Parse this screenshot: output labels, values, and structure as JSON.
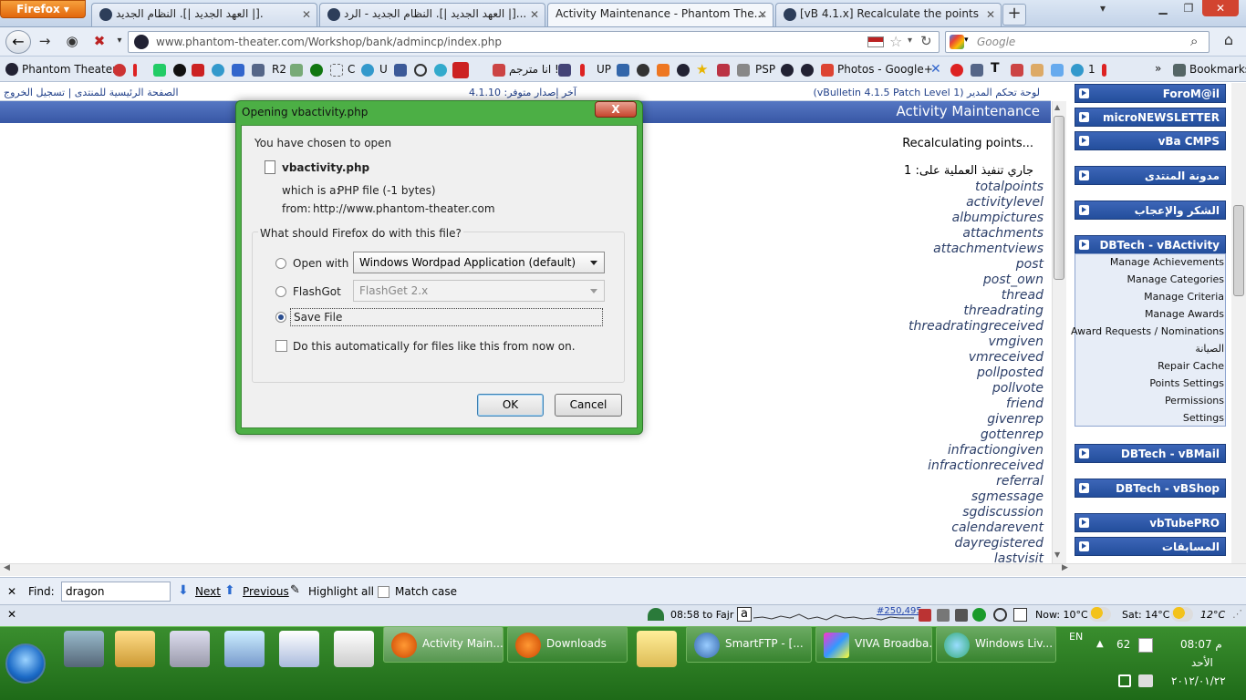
{
  "browser": {
    "menu_button": "Firefox ▾",
    "tabs": [
      {
        "label": "العهد الجديد |]. النظام الجديد |]."
      },
      {
        "label": "العهد الجديد |]. النظام الجديد - الرد |]..."
      },
      {
        "label": "Activity Maintenance - Phantom The..."
      },
      {
        "label": "[vB 4.1.x] Recalculate the points"
      }
    ],
    "url": "www.phantom-theater.com/Workshop/bank/admincp/index.php",
    "search_placeholder": "Google",
    "bookmarks": [
      "Phantom Theater",
      "R2",
      "C",
      "U",
      "انا مترجم !!",
      "UP",
      "PSP",
      "Photos - Google+",
      "1",
      "Bookmarks"
    ]
  },
  "page": {
    "top_left_links": "الصفحة الرئيسية للمنتدى | تسجيل الخروج",
    "top_mid": "آخر إصدار متوفر: 4.1.10",
    "top_right": "لوحة تحكم المدير (vBulletin 4.1.5 Patch Level 1)",
    "header_title": "Activity Maintenance",
    "recalc": "Recalculating points...",
    "running": "جاري تنفيذ العملية على: 1",
    "items": [
      "totalpoints",
      "activitylevel",
      "albumpictures",
      "attachments",
      "attachmentviews",
      "post",
      "post_own",
      "thread",
      "threadrating",
      "threadratingreceived",
      "vmgiven",
      "vmreceived",
      "pollposted",
      "pollvote",
      "friend",
      "givenrep",
      "gottenrep",
      "infractiongiven",
      "infractionreceived",
      "referral",
      "sgmessage",
      "sgdiscussion",
      "calendarevent",
      "dayregistered",
      "lastvisit"
    ]
  },
  "sidebar": {
    "groups": [
      {
        "label": "ForoM@il"
      },
      {
        "label": "microNEWSLETTER"
      },
      {
        "label": "vBa CMPS"
      },
      {
        "label": "مدونة المنتدى"
      },
      {
        "label": "الشكر والإعجاب"
      },
      {
        "label": "DBTech - vBActivity"
      },
      {
        "label": "DBTech - vBMail"
      },
      {
        "label": "DBTech - vBShop"
      },
      {
        "label": "vbTubePRO"
      },
      {
        "label": "المسابقات"
      }
    ],
    "activity_items": [
      "Manage Achievements",
      "Manage Categories",
      "Manage Criteria",
      "Manage Awards",
      "Award Requests / Nominations",
      "الصيانة",
      "Repair Cache",
      "Points Settings",
      "Permissions",
      "Settings"
    ]
  },
  "dialog": {
    "title": "Opening vbactivity.php",
    "close": "X",
    "intro": "You have chosen to open",
    "filename": "vbactivity.php",
    "which_label": "which is a:",
    "which_value": "PHP file (-1 bytes)",
    "from_label": "from:",
    "from_value": "http://www.phantom-theater.com",
    "question": "What should Firefox do with this file?",
    "open_with_label": "Open with",
    "open_with_value": "Windows Wordpad Application (default)",
    "flashgot_label": "FlashGot",
    "flashgot_value": "FlashGet 2.x",
    "save_label": "Save File",
    "auto_label": "Do this automatically for files like this from now on.",
    "ok": "OK",
    "cancel": "Cancel"
  },
  "findbar": {
    "label": "Find:",
    "value": "dragon",
    "next": "Next",
    "previous": "Previous",
    "highlight": "Highlight all",
    "match": "Match case"
  },
  "statusbar": {
    "prayer": "08:58 to Fajr",
    "counter": "#250,495",
    "now": "Now: 10°C",
    "sat": "Sat: 14°C",
    "temp": "12°C"
  },
  "taskbar": {
    "buttons": [
      "Activity Main...",
      "Downloads",
      "SmartFTP - [...",
      "VIVA Broadba...",
      "Windows Liv..."
    ],
    "lang": "EN",
    "num": "62",
    "time": "08:07 م",
    "day": "الأحد",
    "date": "٢٠١٢/٠١/٢٢"
  }
}
